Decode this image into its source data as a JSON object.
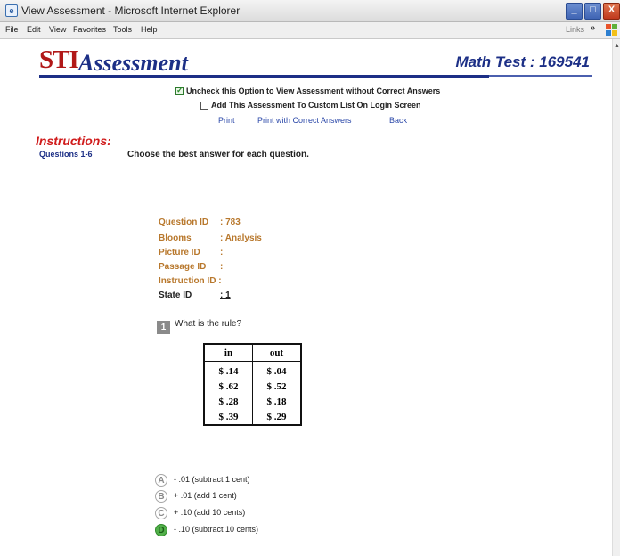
{
  "window": {
    "title": "View Assessment - Microsoft Internet Explorer",
    "app_icon": "ie-icon",
    "menu": [
      "File",
      "Edit",
      "View",
      "Favorites",
      "Tools",
      "Help"
    ],
    "links_label": "Links",
    "chevron": "»",
    "buttons": {
      "minimize": "_",
      "maximize": "□",
      "close": "X"
    }
  },
  "header": {
    "logo_sti": "STI",
    "logo_assessment": "Assessment",
    "test_title": "Math Test : 169541",
    "colors": {
      "brand_red": "#b11818",
      "brand_blue": "#1c2f86"
    }
  },
  "options": {
    "uncheck_label": "Uncheck this Option to View Assessment without Correct Answers",
    "uncheck_checked": true,
    "custom_list_label": "Add This Assessment To Custom List On Login Screen",
    "custom_list_checked": false
  },
  "links": {
    "print": "Print",
    "print_with_answers": "Print with Correct Answers",
    "back": "Back"
  },
  "instructions": {
    "heading": "Instructions:",
    "question_range": "Questions 1-6",
    "text": "Choose the best answer for each question."
  },
  "question_meta": {
    "question_id_label": "Question ID",
    "question_id_value": ": 783",
    "blooms_label": "Blooms",
    "blooms_value": ": Analysis",
    "picture_id_label": "Picture ID",
    "picture_id_value": ":",
    "passage_id_label": "Passage ID",
    "passage_id_value": ":",
    "instruction_id_label": "Instruction ID :",
    "state_id_label": "State ID",
    "state_id_value": ": 1"
  },
  "question": {
    "number": "1",
    "text": "What is the rule?",
    "table": {
      "headers": [
        "in",
        "out"
      ],
      "rows": [
        [
          "$ .14",
          "$ .04"
        ],
        [
          "$ .62",
          "$ .52"
        ],
        [
          "$ .28",
          "$ .18"
        ],
        [
          "$ .39",
          "$ .29"
        ]
      ]
    },
    "answers": [
      {
        "letter": "A",
        "text": "- .01 (subtract 1 cent)",
        "correct": false
      },
      {
        "letter": "B",
        "text": "+ .01 (add 1 cent)",
        "correct": false
      },
      {
        "letter": "C",
        "text": "+ .10 (add 10 cents)",
        "correct": false
      },
      {
        "letter": "D",
        "text": "- .10 (subtract 10 cents)",
        "correct": true
      }
    ]
  }
}
